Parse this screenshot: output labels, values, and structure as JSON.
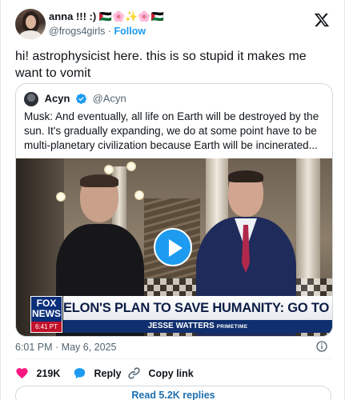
{
  "author": {
    "display_name": "anna !!! :) 🇵🇸🌸✨🌸🇵🇸",
    "handle": "@frogs4girls",
    "separator": "·",
    "follow_label": "Follow"
  },
  "tweet": {
    "text": "hi! astrophysicist here. this is so stupid it makes me want to vomit",
    "timestamp": "6:01 PM · May 6, 2025"
  },
  "quoted": {
    "display_name": "Acyn",
    "handle": "@Acyn",
    "text": "Musk: And eventually, all life on Earth will be destroyed by the sun. It's gradually expanding, we do at some point have to be multi-planetary civilization because Earth will be incinerated..."
  },
  "video": {
    "network_top": "FOX",
    "network_bottom": "NEWS",
    "clock": "6:41 PT",
    "headline": "ELON'S PLAN TO SAVE HUMANITY: GO TO MARS",
    "show": "JESSE WATTERS",
    "show_tag": "PRIMETIME"
  },
  "actions": {
    "likes": "219K",
    "reply_label": "Reply",
    "copy_label": "Copy link",
    "read_replies": "Read 5.2K replies"
  },
  "colors": {
    "accent": "#1d9bf0",
    "like": "#f91880",
    "text": "#0f1419",
    "muted": "#536471"
  }
}
